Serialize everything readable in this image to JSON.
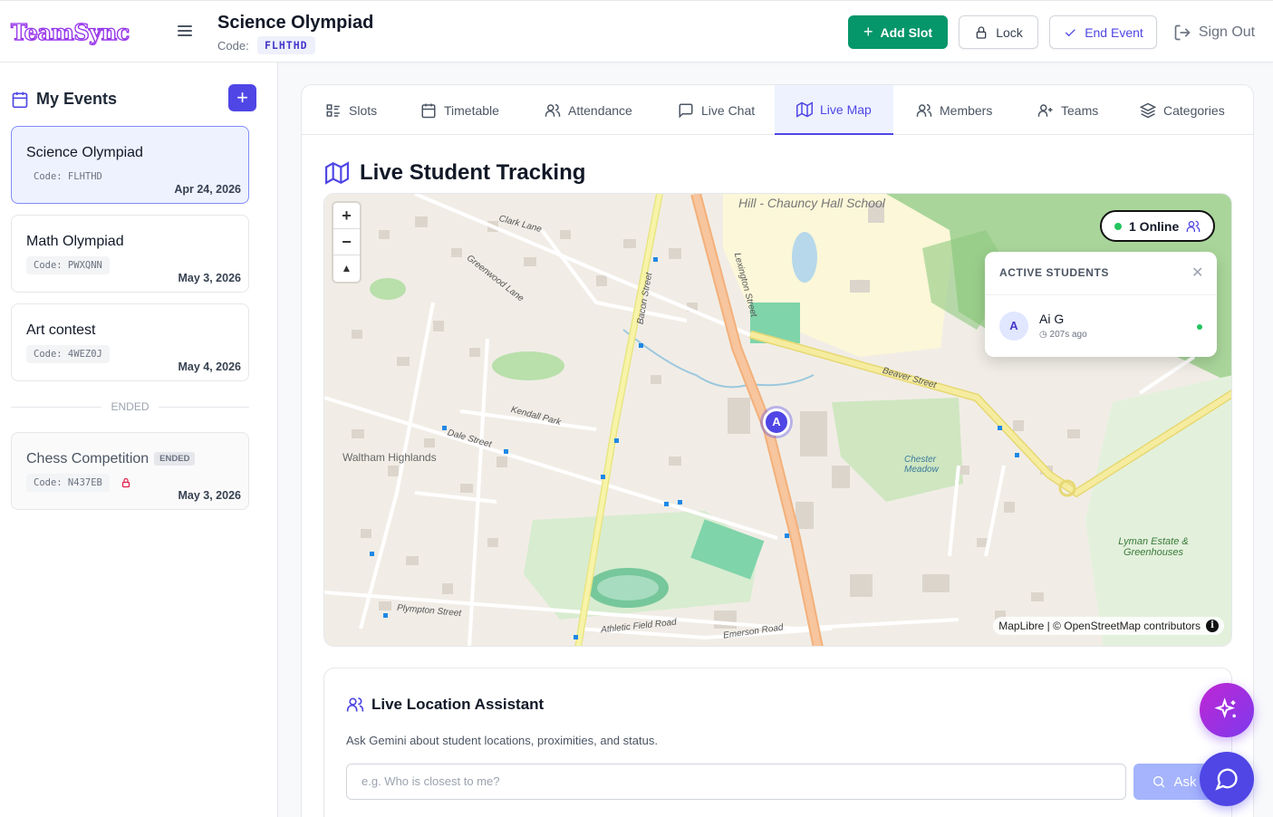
{
  "app": {
    "logo": "TeamSync"
  },
  "header": {
    "event_title": "Science Olympiad",
    "code_label": "Code:",
    "code": "FLHTHD",
    "add_slot": "Add Slot",
    "lock": "Lock",
    "end_event": "End Event",
    "sign_out": "Sign Out",
    "colors": {
      "add": "#059669",
      "accent": "#4f46e5"
    }
  },
  "sidebar": {
    "title": "My Events",
    "events": [
      {
        "name": "Science Olympiad",
        "code": "Code: FLHTHD",
        "date": "Apr 24, 2026"
      },
      {
        "name": "Math Olympiad",
        "code": "Code: PWXQNN",
        "date": "May 3, 2026"
      },
      {
        "name": "Art contest",
        "code": "Code: 4WEZ0J",
        "date": "May 4, 2026"
      }
    ],
    "ended_separator": "ENDED",
    "ended_events": [
      {
        "name": "Chess Competition",
        "badge": "ENDED",
        "code": "Code: N437EB",
        "date": "May 3, 2026"
      }
    ]
  },
  "tabs": [
    {
      "label": "Slots",
      "icon": "list-icon"
    },
    {
      "label": "Timetable",
      "icon": "calendar-icon"
    },
    {
      "label": "Attendance",
      "icon": "users-icon"
    },
    {
      "label": "Live Chat",
      "icon": "chat-icon"
    },
    {
      "label": "Live Map",
      "icon": "map-icon"
    },
    {
      "label": "Members",
      "icon": "users-icon"
    },
    {
      "label": "Teams",
      "icon": "user-plus-icon"
    },
    {
      "label": "Categories",
      "icon": "layers-icon"
    }
  ],
  "live_map": {
    "title": "Live Student Tracking",
    "online_count": "1 Online",
    "active_students_title": "ACTIVE STUDENTS",
    "students": [
      {
        "initial": "A",
        "name": "Ai G",
        "last_seen": "207s ago"
      }
    ],
    "marker_initial": "A",
    "attribution": "MapLibre | © OpenStreetMap contributors",
    "labels": {
      "school": "Hill - Chauncy Hall School",
      "highlands": "Waltham Highlands",
      "lexington": "Lexington Street",
      "bacon": "Bacon Street",
      "dale": "Dale Street",
      "beaver": "Beaver Street",
      "lyman": "Lyman Estate & Greenhouses",
      "chester": "Chester Meadow",
      "athletic": "Athletic Field Road",
      "emerson": "Emerson Road",
      "plympton": "Plympton Street",
      "kendall": "Kendall Park",
      "greenwood": "Greenwood Lane",
      "clark": "Clark Lane"
    }
  },
  "assistant": {
    "title": "Live Location Assistant",
    "subtitle": "Ask Gemini about student locations, proximities, and status.",
    "placeholder": "e.g. Who is closest to me?",
    "ask": "Ask"
  }
}
